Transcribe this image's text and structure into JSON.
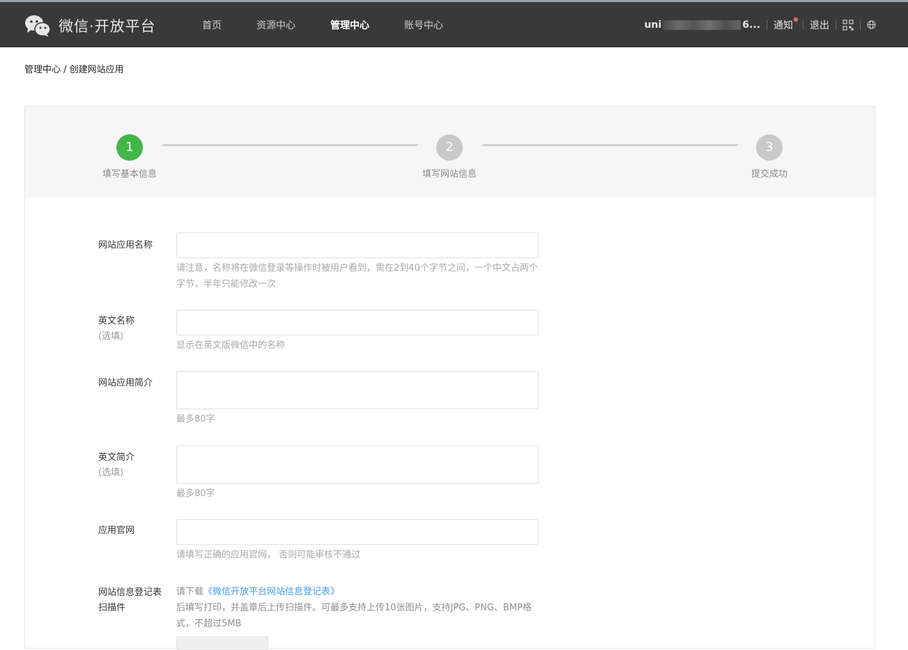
{
  "header": {
    "logo_text": "微信·开放平台",
    "nav": [
      {
        "label": "首页"
      },
      {
        "label": "资源中心"
      },
      {
        "label": "管理中心"
      },
      {
        "label": "账号中心"
      }
    ],
    "username_prefix": "uni",
    "username_suffix": "6...",
    "notify_label": "通知",
    "logout_label": "退出"
  },
  "breadcrumb": "管理中心 / 创建网站应用",
  "steps": [
    {
      "num": "1",
      "label": "填写基本信息",
      "color": "#44b549"
    },
    {
      "num": "2",
      "label": "填写网站信息",
      "color": "#c9c9c9"
    },
    {
      "num": "3",
      "label": "提交成功",
      "color": "#c9c9c9"
    }
  ],
  "form": {
    "app_name": {
      "label": "网站应用名称",
      "value": "",
      "hint": "请注意，名称将在微信登录等操作时被用户看到，需在2到40个字节之间，一个中文占两个字节，半年只能修改一次"
    },
    "en_name": {
      "label": "英文名称",
      "optional": "(选填)",
      "value": "",
      "hint": "显示在英文版微信中的名称"
    },
    "intro": {
      "label": "网站应用简介",
      "value": "",
      "hint": "最多80字"
    },
    "en_intro": {
      "label": "英文简介",
      "optional": "(选填)",
      "value": "",
      "hint": "最多80字"
    },
    "website": {
      "label": "应用官网",
      "value": "",
      "hint": "请填写正确的应用官网， 否则可能审核不通过"
    },
    "scan": {
      "label_line1": "网站信息登记表",
      "label_line2": "扫描件",
      "download_prefix": "请下载",
      "download_link": "《微信开放平台网站信息登记表》",
      "desc": "后填写打印，并盖章后上传扫描件。可最多支持上传10张图片，支持JPG、PNG、BMP格式，不超过5MB"
    }
  }
}
